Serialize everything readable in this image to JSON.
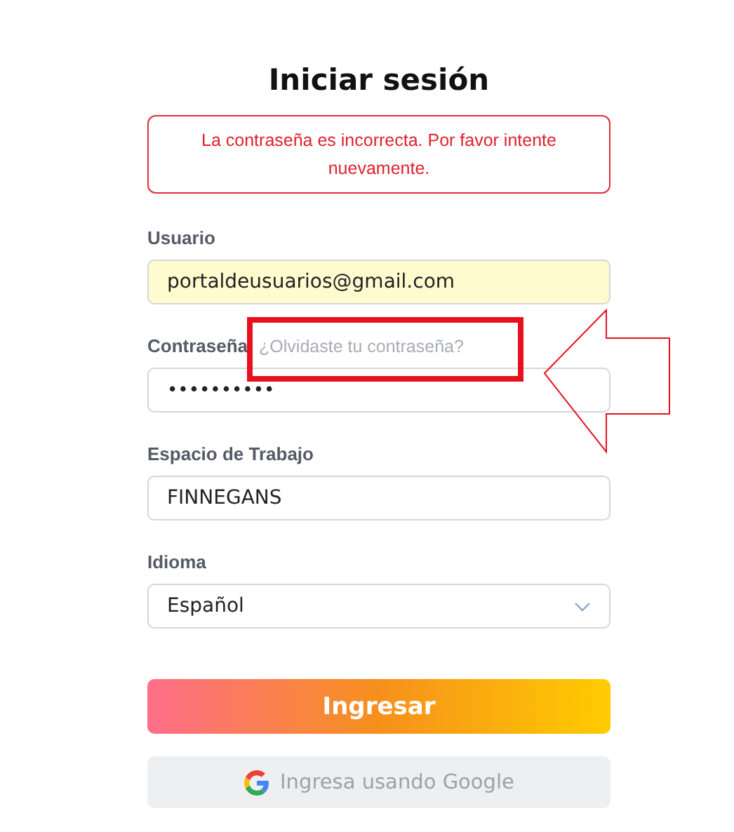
{
  "title": "Iniciar sesión",
  "error": "La contraseña es incorrecta. Por favor intente nuevamente.",
  "fields": [
    {
      "kind": "text",
      "label": "Usuario",
      "value": "portaldeusuarios@gmail.com",
      "autofilled": true
    },
    {
      "kind": "password",
      "label": "Contraseña",
      "link": "¿Olvidaste tu contraseña?",
      "value": "••••••••••"
    },
    {
      "kind": "text",
      "label": "Espacio de Trabajo",
      "value": "FINNEGANS"
    },
    {
      "kind": "select",
      "label": "Idioma",
      "value": "Español"
    }
  ],
  "submit": "Ingresar",
  "google": "Ingresa usando Google"
}
